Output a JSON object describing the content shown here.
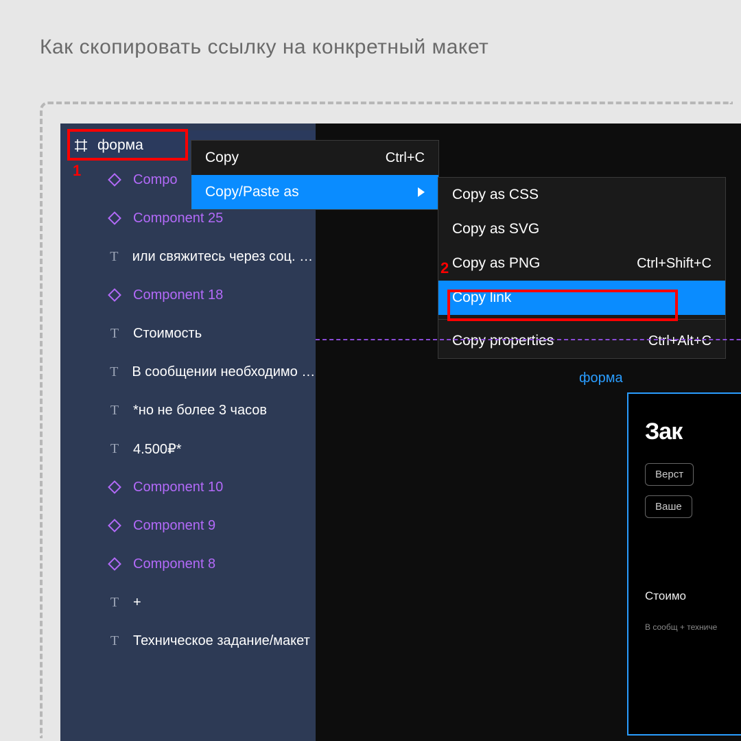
{
  "page_title": "Как скопировать ссылку на конкретный макет",
  "annotations": {
    "step1": "1",
    "step2": "2"
  },
  "sidebar": {
    "frame": {
      "label": "форма"
    },
    "layers": [
      {
        "type": "component",
        "label": "Compo"
      },
      {
        "type": "component",
        "label": "Component 25"
      },
      {
        "type": "text",
        "label": "или свяжитесь через соц. се..."
      },
      {
        "type": "component",
        "label": "Component 18"
      },
      {
        "type": "text",
        "label": "Стоимость"
      },
      {
        "type": "text",
        "label": "В сообщении необходимо пр..."
      },
      {
        "type": "text",
        "label": "*но не более 3 часов"
      },
      {
        "type": "text",
        "label": "4.500₽*"
      },
      {
        "type": "component",
        "label": "Component 10"
      },
      {
        "type": "component",
        "label": "Component 9"
      },
      {
        "type": "component",
        "label": "Component 8"
      },
      {
        "type": "text",
        "label": "+"
      },
      {
        "type": "text",
        "label": "Техническое задание/макет"
      }
    ]
  },
  "menu1": {
    "items": [
      {
        "label": "Copy",
        "shortcut": "Ctrl+C",
        "hover": false,
        "submenu": false
      },
      {
        "label": "Copy/Paste as",
        "shortcut": "",
        "hover": true,
        "submenu": true
      }
    ]
  },
  "menu2": {
    "items": [
      {
        "label": "Copy as CSS",
        "shortcut": "",
        "hover": false
      },
      {
        "label": "Copy as SVG",
        "shortcut": "",
        "hover": false
      },
      {
        "label": "Copy as PNG",
        "shortcut": "Ctrl+Shift+C",
        "hover": false
      },
      {
        "label": "Copy link",
        "shortcut": "",
        "hover": true
      },
      {
        "sep": true
      },
      {
        "label": "Copy properties",
        "shortcut": "Ctrl+Alt+C",
        "hover": false
      }
    ]
  },
  "canvas": {
    "frame_label": "форма",
    "title": "Зак",
    "chip1": "Верст",
    "chip2": "Ваше",
    "section": "Стоимо",
    "small": "В сообщ\n+ техниче"
  }
}
